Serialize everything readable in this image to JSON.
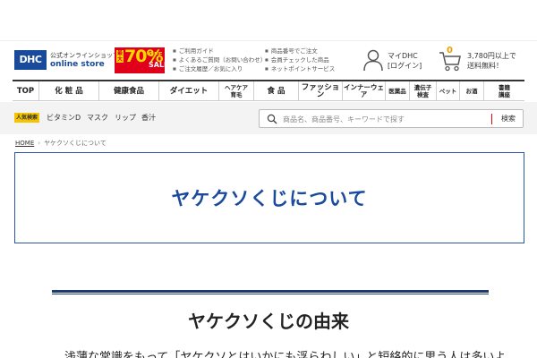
{
  "header": {
    "logo_text": "DHC",
    "store_line1": "公式オンラインショップ",
    "store_line2": "online store",
    "sale": {
      "tag": "最大",
      "percent": "70%",
      "off": "OFF",
      "word": "SALE"
    },
    "links_col1": [
      "ご利用ガイド",
      "よくあるご質問（お問い合わせ）",
      "ご注文履歴／お気に入り"
    ],
    "links_col2": [
      "商品番号でご注文",
      "会員チェックした商品",
      "ネットポイントサービス"
    ],
    "mypage_name": "マイDHC",
    "mypage_login": "[ログイン]",
    "cart_count": "0",
    "free_shipping_line1": "3,780円以上で",
    "free_shipping_line2": "送料無料！",
    "icons": {
      "mypage": "person-icon",
      "cart": "cart-icon"
    }
  },
  "nav": {
    "items": [
      {
        "label": "TOP",
        "small": false
      },
      {
        "label": "化 粧 品",
        "small": false
      },
      {
        "label": "健康食品",
        "small": false
      },
      {
        "label": "ダイエット",
        "small": false
      },
      {
        "label": "ヘアケア\n育毛",
        "small": true
      },
      {
        "label": "食 品",
        "small": false
      },
      {
        "label": "ファッション",
        "small": false
      },
      {
        "label": "インナーウェア",
        "small": false
      },
      {
        "label": "医薬品",
        "small": true
      },
      {
        "label": "遺伝子\n検査",
        "small": true
      },
      {
        "label": "ペット",
        "small": true
      },
      {
        "label": "お酒",
        "small": true
      },
      {
        "label": "書籍\n講座",
        "small": true
      }
    ]
  },
  "search": {
    "popular_tag": "人気検索",
    "popular_words": [
      "ビタミンD",
      "マスク",
      "リップ",
      "香汁"
    ],
    "placeholder": "商品名、商品番号、キーワードで探す",
    "button_label": "検索",
    "icon": "search-icon"
  },
  "breadcrumb": {
    "home": "HOME",
    "separator": "›",
    "current": "ヤケクソくじについて"
  },
  "page": {
    "title": "ヤケクソくじについて",
    "section_title": "ヤケクソくじの由来",
    "body_text": "浅薄な常識をもって「ヤケクソとはいかにも浮らわしい」と短絡的に思う人は多いよ"
  },
  "colors": {
    "brand_blue": "#1a4a9c",
    "sale_red": "#e0001b",
    "sale_yellow": "#ffd800",
    "popular_yellow": "#f5c400"
  }
}
